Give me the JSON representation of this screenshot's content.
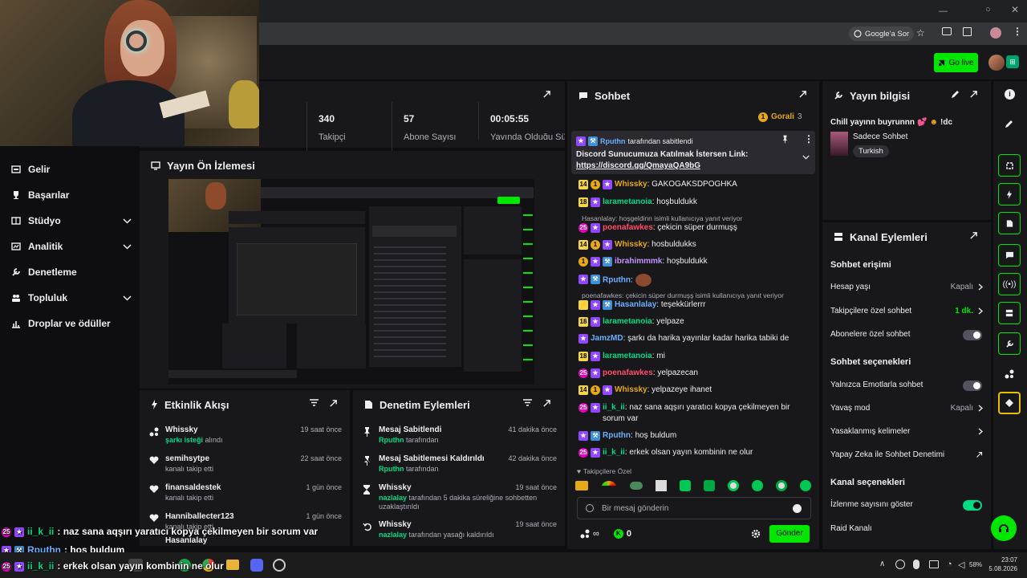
{
  "browser": {
    "google_sor": "Google'a Sor"
  },
  "appbar": {
    "go_live": "Go live"
  },
  "stats": [
    {
      "value": "340",
      "label": "Takipçi"
    },
    {
      "value": "57",
      "label": "Abone Sayısı"
    },
    {
      "value": "00:05:55",
      "label": "Yayında Olduğu Süre"
    }
  ],
  "nav": {
    "items": [
      {
        "label": "Gelir"
      },
      {
        "label": "Başarılar"
      },
      {
        "label": "Stüdyo"
      },
      {
        "label": "Analitik"
      },
      {
        "label": "Denetleme"
      },
      {
        "label": "Topluluk"
      },
      {
        "label": "Droplar ve ödüller"
      }
    ]
  },
  "preview": {
    "title": "Yayın Ön İzlemesi"
  },
  "activity": {
    "title": "Etkinlik Akışı",
    "items": [
      {
        "name": "Whissky",
        "desc_hl": "şarkı isteği",
        "desc": " alındı",
        "time": "19 saat önce"
      },
      {
        "name": "semihsytpe",
        "desc": "kanalı takip etti",
        "time": "22 saat önce"
      },
      {
        "name": "finansaldestek",
        "desc": "kanalı takip etti",
        "time": "1 gün önce"
      },
      {
        "name": "Hanniballecter123",
        "desc": "kanalı takip etti",
        "time": "1 gün önce"
      },
      {
        "name": "Hasanlalay",
        "desc": "",
        "time": ""
      }
    ]
  },
  "moderation": {
    "title": "Denetim Eylemleri",
    "items": [
      {
        "title": "Mesaj Sabitlendi",
        "who": "Rputhn",
        "desc": " tarafından",
        "time": "41 dakika önce"
      },
      {
        "title": "Mesaj Sabitlemesi Kaldırıldı",
        "who": "Rputhn",
        "desc": " tarafından",
        "time": "42 dakika önce"
      },
      {
        "title": "Whissky",
        "who": "nazlalay",
        "desc": " tarafından 5 dakika süreliğine sohbetten uzaklaştırıldı",
        "time": "19 saat önce"
      },
      {
        "title": "Whissky",
        "who": "nazlalay",
        "desc": " tarafından yasağı kaldırıldı",
        "time": "19 saat önce"
      }
    ]
  },
  "chat": {
    "title": "Sohbet",
    "goal_label": "Gorali",
    "goal_count": "3",
    "pinned_by_user": "Rputhn",
    "pinned_by": " tarafından sabitlendi",
    "pinned_text": "Discord Sunucumuza Katılmak İstersen Link:",
    "pinned_link": "https://discord.gg/QmayaQA9bG",
    "messages": [
      {
        "user": "Whissky",
        "color": "#e6a817",
        "text": "GAKOGAKSDPOGHKA"
      },
      {
        "user": "larametanoia",
        "color": "#00db84",
        "text": "hoşbuldukk"
      },
      {
        "reply": "Hasanlalay: hoşgeldinn isimli kullanıcıya yanıt veriyor"
      },
      {
        "user": "poenafawkes",
        "color": "#ff4d6d",
        "text": "çekicin süper durmuşş"
      },
      {
        "user": "Whissky",
        "color": "#e6a817",
        "text": "hosbuldukks"
      },
      {
        "user": "ibrahimmmk",
        "color": "#bf94ff",
        "text": "hoşbuldukk"
      },
      {
        "user": "Rputhn",
        "color": "#6ab0ff",
        "text": ""
      },
      {
        "reply": "poenafawkes: çekicin süper durmuşş isimli kullanıcıya yanıt veriyor"
      },
      {
        "user": "Hasanlalay",
        "color": "#6ab0ff",
        "text": "teşekkürlerrr"
      },
      {
        "user": "larametanoia",
        "color": "#00db84",
        "text": "yelpaze"
      },
      {
        "user": "JamzMD",
        "color": "#6ab0ff",
        "text": "şarkı da harika yayınlar kadar harika tabiki de"
      },
      {
        "user": "larametanoia",
        "color": "#00db84",
        "text": "mi"
      },
      {
        "user": "poenafawkes",
        "color": "#ff4d6d",
        "text": "yelpazecan"
      },
      {
        "user": "Whissky",
        "color": "#e6a817",
        "text": "yelpazeye ihanet"
      },
      {
        "user": "ii_k_ii",
        "color": "#00db84",
        "text": "naz sana aqşırı yaratıcı kopya çekilmeyen bir sorum var"
      },
      {
        "user": "Rputhn",
        "color": "#6ab0ff",
        "text": "hoş buldum"
      },
      {
        "user": "ii_k_ii",
        "color": "#00db84",
        "text": "erkek olsan yayın kombinin ne olur"
      }
    ],
    "followers_only": "Takipçilere Özel",
    "input_placeholder": "Bir mesaj gönderin",
    "points": "0",
    "send": "Gönder"
  },
  "stream_info": {
    "title": "Yayın bilgisi",
    "stream_title": "Chill yayınn buyrunnn",
    "stream_title_suffix": "!dc",
    "category": "Sadece Sohbet",
    "tag": "Turkish"
  },
  "channel_actions": {
    "title": "Kanal Eylemleri",
    "sec1": "Sohbet erişimi",
    "hesap_yasi": "Hesap yaşı",
    "hesap_yasi_val": "Kapalı",
    "takipci_sohbet": "Takipçilere özel sohbet",
    "takipci_sohbet_val": "1 dk.",
    "abone_sohbet": "Abonelere özel sohbet",
    "sec2": "Sohbet seçenekleri",
    "emote": "Yalnızca Emotlarla sohbet",
    "yavas": "Yavaş mod",
    "yavas_val": "Kapalı",
    "yasak": "Yasaklanmış kelimeler",
    "ai": "Yapay Zeka ile Sohbet Denetimi",
    "sec3": "Kanal seçenekleri",
    "izlenme": "İzlenme sayısını göster",
    "raid": "Raid Kanalı"
  },
  "overlay": [
    {
      "user": "ii_k_ii",
      "text": ": naz sana aqşırı yaratıcı kopya çekilmeyen bir sorum var"
    },
    {
      "user": "Rputhn",
      "text": ": hoş buldum"
    },
    {
      "user": "ii_k_ii",
      "text": ": erkek olsan yayın kombinin ne olur"
    }
  ],
  "taskbar": {
    "battery": "58%",
    "time": "23:07",
    "date": "5.08.2026"
  },
  "colors": {
    "accent": "#00e701",
    "bg": "#0e0e10",
    "panel": "#18181b"
  }
}
